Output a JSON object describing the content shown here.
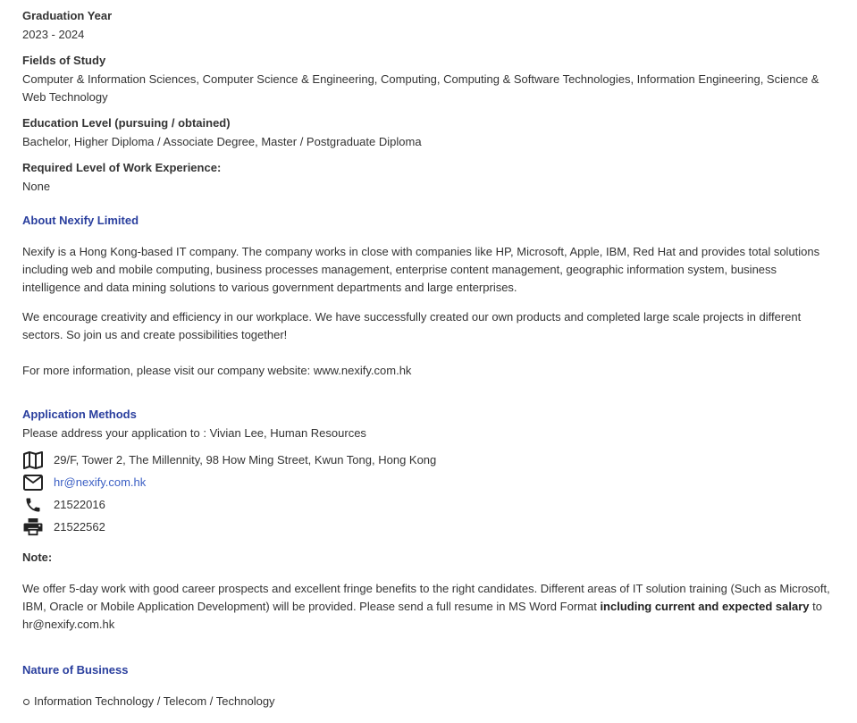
{
  "graduation": {
    "label": "Graduation Year",
    "value": "2023 - 2024"
  },
  "fields": {
    "label": "Fields of Study",
    "value": "Computer & Information Sciences, Computer Science & Engineering, Computing, Computing & Software Technologies, Information Engineering, Science & Web Technology"
  },
  "education": {
    "label": "Education Level (pursuing / obtained)",
    "value": "Bachelor, Higher Diploma / Associate Degree, Master / Postgraduate Diploma"
  },
  "experience": {
    "label": "Required Level of Work Experience:",
    "value": "None"
  },
  "about": {
    "title": "About Nexify Limited",
    "para1": "Nexify is a Hong Kong-based IT company. The company works in close with companies like HP, Microsoft, Apple, IBM, Red Hat and provides total solutions including web and mobile computing, business processes management, enterprise content management, geographic information system, business intelligence and data mining solutions to various government departments and large enterprises.",
    "para2": "We encourage creativity and efficiency in our workplace. We have successfully created our own products and completed large scale projects in different sectors. So join us and create possibilities together!",
    "para3": "For more information, please visit our company website: www.nexify.com.hk"
  },
  "application": {
    "title": "Application Methods",
    "address_to": "Please address your application to : Vivian Lee, Human Resources",
    "contacts": [
      {
        "icon": "map-icon",
        "text": "29/F, Tower 2, The Millennity, 98 How Ming Street, Kwun Tong, Hong Kong"
      },
      {
        "icon": "mail-icon",
        "text": "hr@nexify.com.hk"
      },
      {
        "icon": "phone-icon",
        "text": "21522016"
      },
      {
        "icon": "fax-icon",
        "text": "21522562"
      }
    ],
    "link_color": "#3b5fc4"
  },
  "note": {
    "label": "Note:",
    "text_before": "We offer 5-day work with good career prospects and excellent fringe benefits to the right candidates. Different areas of IT solution training (Such as Microsoft, IBM, Oracle or Mobile Application Development) will be provided. Please send a full resume in MS Word Format ",
    "text_bold": "including current and expected salary",
    "text_after": " to hr@nexify.com.hk"
  },
  "business": {
    "title": "Nature of Business",
    "items": [
      "Information Technology / Telecom / Technology"
    ]
  },
  "colors": {
    "section_title": "#2a3f9e",
    "text": "#333333"
  }
}
